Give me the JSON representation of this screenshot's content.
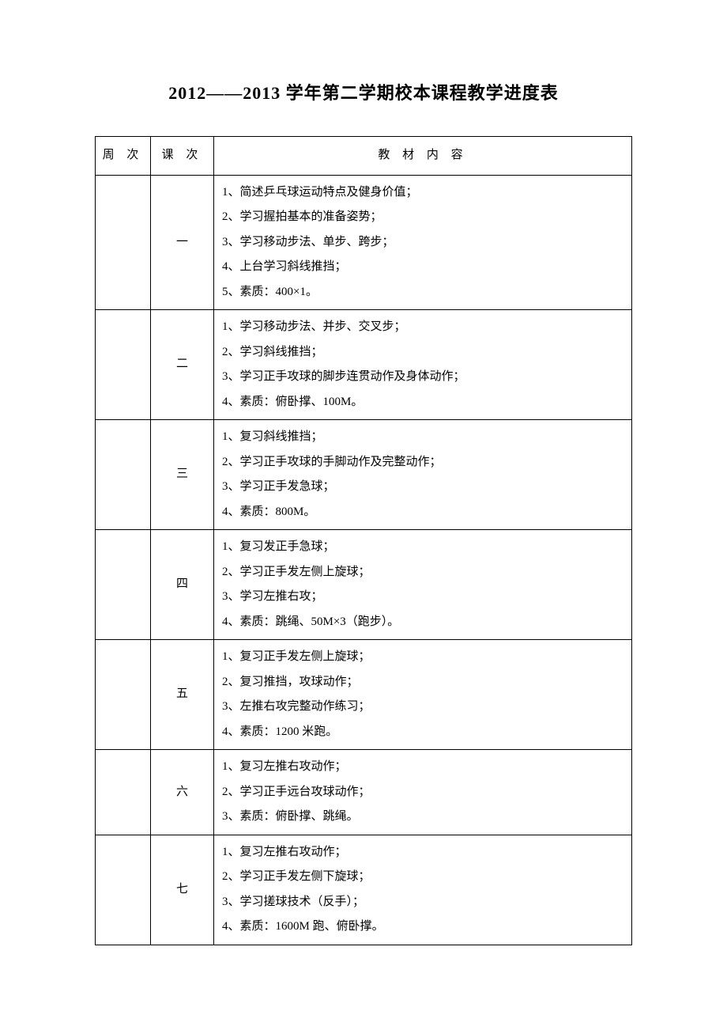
{
  "title": "2012——2013 学年第二学期校本课程教学进度表",
  "headers": {
    "week": "周 次",
    "lesson": "课 次",
    "content": "教 材 内 容"
  },
  "rows": [
    {
      "week": "",
      "lesson": "一",
      "content": [
        "1、简述乒乓球运动特点及健身价值；",
        "2、学习握拍基本的准备姿势；",
        "3、学习移动步法、单步、跨步；",
        "4、上台学习斜线推挡；",
        "5、素质：400×1。"
      ]
    },
    {
      "week": "",
      "lesson": "二",
      "content": [
        "1、学习移动步法、并步、交叉步；",
        "2、学习斜线推挡；",
        "3、学习正手攻球的脚步连贯动作及身体动作；",
        "4、素质：俯卧撑、100M。"
      ]
    },
    {
      "week": "",
      "lesson": "三",
      "content": [
        "1、复习斜线推挡；",
        "2、学习正手攻球的手脚动作及完整动作；",
        "3、学习正手发急球；",
        "4、素质：800M。"
      ]
    },
    {
      "week": "",
      "lesson": "四",
      "content": [
        "1、复习发正手急球；",
        "2、学习正手发左侧上旋球；",
        "3、学习左推右攻；",
        "4、素质：跳绳、50M×3（跑步）。"
      ]
    },
    {
      "week": "",
      "lesson": "五",
      "content": [
        "1、复习正手发左侧上旋球；",
        "2、复习推挡，攻球动作；",
        "3、左推右攻完整动作练习；",
        "4、素质：1200 米跑。"
      ]
    },
    {
      "week": "",
      "lesson": "六",
      "content": [
        "1、复习左推右攻动作；",
        "2、学习正手远台攻球动作；",
        "3、素质：俯卧撑、跳绳。"
      ]
    },
    {
      "week": "",
      "lesson": "七",
      "content": [
        "1、复习左推右攻动作；",
        "2、学习正手发左侧下旋球；",
        "3、学习搓球技术（反手）；",
        "4、素质：1600M 跑、俯卧撑。"
      ]
    }
  ]
}
